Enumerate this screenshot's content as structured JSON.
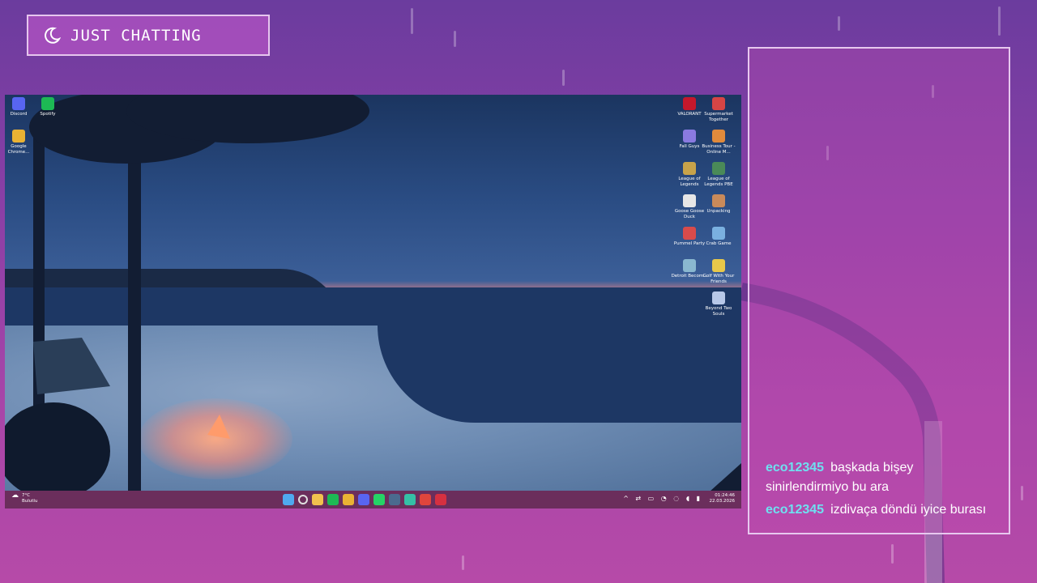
{
  "overlay": {
    "title": "JUST CHATTING",
    "title_icon": "moon-icon"
  },
  "chat": {
    "messages": [
      {
        "user": "eco12345",
        "text": "başkada bişey sinirlendirmiyo bu ara"
      },
      {
        "user": "eco12345",
        "text": "izdivaça döndü iyice burası"
      }
    ]
  },
  "desktop": {
    "left_icons": [
      {
        "label": "Discord",
        "color": "#5865f2"
      },
      {
        "label": "Spotify",
        "color": "#1db954"
      },
      {
        "label": "Google Chrome...",
        "color": "#e9b234"
      }
    ],
    "right_icons": [
      {
        "label": "VALORANT",
        "color": "#c4182c"
      },
      {
        "label": "Supermarket Together",
        "color": "#d64545"
      },
      {
        "label": "Fall Guys",
        "color": "#8a7ae0"
      },
      {
        "label": "Business Tour - Online M...",
        "color": "#e08a3c"
      },
      {
        "label": "League of Legends",
        "color": "#c8a34a"
      },
      {
        "label": "League of Legends PBE",
        "color": "#4a8a58"
      },
      {
        "label": "Goose Goose Duck",
        "color": "#e6e6e6"
      },
      {
        "label": "Unpacking",
        "color": "#c98a5a"
      },
      {
        "label": "Pummel Party",
        "color": "#d84b4b"
      },
      {
        "label": "Crab Game",
        "color": "#7ab0e0"
      },
      {
        "label": "Detroit Becom...",
        "color": "#8ab8d0"
      },
      {
        "label": "Golf With Your Friends",
        "color": "#e8c84a"
      },
      {
        "label": "Beyond Two Souls",
        "color": "#b8c8e8"
      }
    ],
    "taskbar": {
      "weather_temp": "7°C",
      "weather_desc": "Bulutlu",
      "time": "01:24:46",
      "date": "22.03.2026",
      "apps": [
        "start-icon",
        "search-icon",
        "folder-icon",
        "spotify-icon",
        "chrome-icon",
        "discord-icon",
        "whatsapp-icon",
        "steam-icon",
        "app-icon",
        "youtube-icon",
        "valorant-icon"
      ],
      "app_colors": [
        "#4fa9f0",
        "#e0e0e0",
        "#f2c14e",
        "#1db954",
        "#e9b234",
        "#5865f2",
        "#25d366",
        "#4b6a8f",
        "#35c0a6",
        "#e0453c",
        "#d63040"
      ]
    }
  }
}
